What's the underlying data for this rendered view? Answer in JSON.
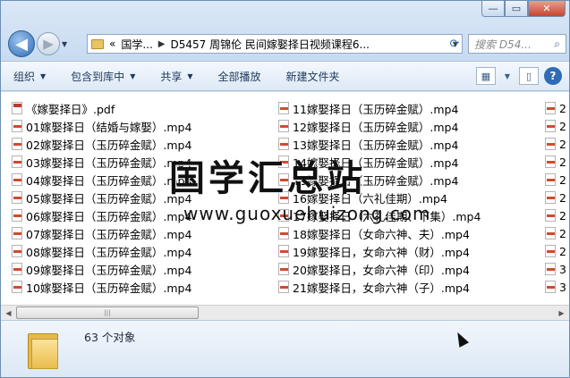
{
  "window_buttons": {
    "minimize": "—",
    "maximize": "▭",
    "close": "✕"
  },
  "address": {
    "lead": "«",
    "crumbs": [
      "国学...",
      "D5457 周锦伦 民间嫁娶择日视频课程6..."
    ],
    "refresh_icon": "refresh-icon"
  },
  "search": {
    "placeholder": "搜索 D54..."
  },
  "toolbar": {
    "organize": "组织",
    "include": "包含到库中",
    "share": "共享",
    "play_all": "全部播放",
    "new_folder": "新建文件夹"
  },
  "files_col1": [
    "《嫁娶择日》.pdf",
    "01嫁娶择日（结婚与嫁娶）.mp4",
    "02嫁娶择日（玉历碎金赋）.mp4",
    "03嫁娶择日（玉历碎金赋）.mp4",
    "04嫁娶择日（玉历碎金赋）.mp4",
    "05嫁娶择日（玉历碎金赋）.mp4",
    "06嫁娶择日（玉历碎金赋）.mp4",
    "07嫁娶择日（玉历碎金赋）.mp4",
    "08嫁娶择日（玉历碎金赋）.mp4",
    "09嫁娶择日（玉历碎金赋）.mp4",
    "10嫁娶择日（玉历碎金赋）.mp4"
  ],
  "files_col2": [
    "11嫁娶择日（玉历碎金赋）.mp4",
    "12嫁娶择日（玉历碎金赋）.mp4",
    "13嫁娶择日（玉历碎金赋）.mp4",
    "14嫁娶择日（玉历碎金赋）.mp4",
    "15嫁娶择日（玉历碎金赋）.mp4",
    "16嫁娶择日（六礼佳期）.mp4",
    "17嫁娶择日（六礼佳期、下集）.mp4",
    "18嫁娶择日（女命六神、夫）.mp4",
    "19嫁娶择日，女命六神（财）.mp4",
    "20嫁娶择日，女命六神（印）.mp4",
    "21嫁娶择日，女命六神（子）.mp4"
  ],
  "files_col3": [
    "2",
    "2",
    "2",
    "2",
    "2",
    "2",
    "2",
    "2",
    "2",
    "3",
    "3"
  ],
  "watermark": {
    "title": "国学汇总站",
    "url": "www.guoxuehuizong.com"
  },
  "status": {
    "count": "63 个对象"
  }
}
